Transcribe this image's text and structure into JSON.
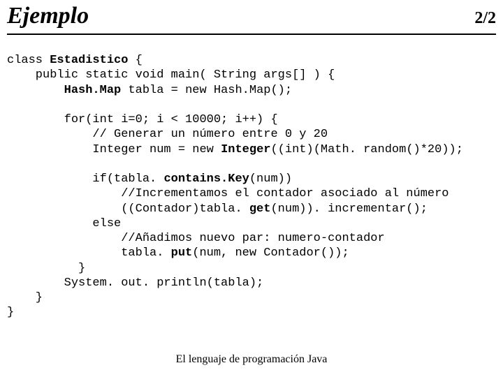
{
  "header": {
    "title": "Ejemplo",
    "pager": "2/2"
  },
  "code": {
    "l01a": "class ",
    "l01b": "Estadistico",
    "l01c": " {",
    "l02": "    public static void main( String args[] ) {",
    "l03a": "        ",
    "l03b": "Hash.Map",
    "l03c": " tabla = new Hash.Map();",
    "l04": "",
    "l05": "        for(int i=0; i < 10000; i++) {",
    "l06": "            // Generar un número entre 0 y 20",
    "l07a": "            Integer num = new ",
    "l07b": "Integer",
    "l07c": "((int)(Math. random()*20));",
    "l08": "",
    "l09a": "            if(tabla. ",
    "l09b": "contains.Key",
    "l09c": "(num))",
    "l10": "                //Incrementamos el contador asociado al número",
    "l11a": "                ((Contador)tabla. ",
    "l11b": "get",
    "l11c": "(num)). incrementar();",
    "l12": "            else",
    "l13": "                //Añadimos nuevo par: numero-contador",
    "l14a": "                tabla. ",
    "l14b": "put",
    "l14c": "(num, new Contador());",
    "l15": "          }",
    "l16": "        System. out. println(tabla);",
    "l17": "    }",
    "l18": "}"
  },
  "footer": {
    "text": "El lenguaje de programación Java"
  }
}
